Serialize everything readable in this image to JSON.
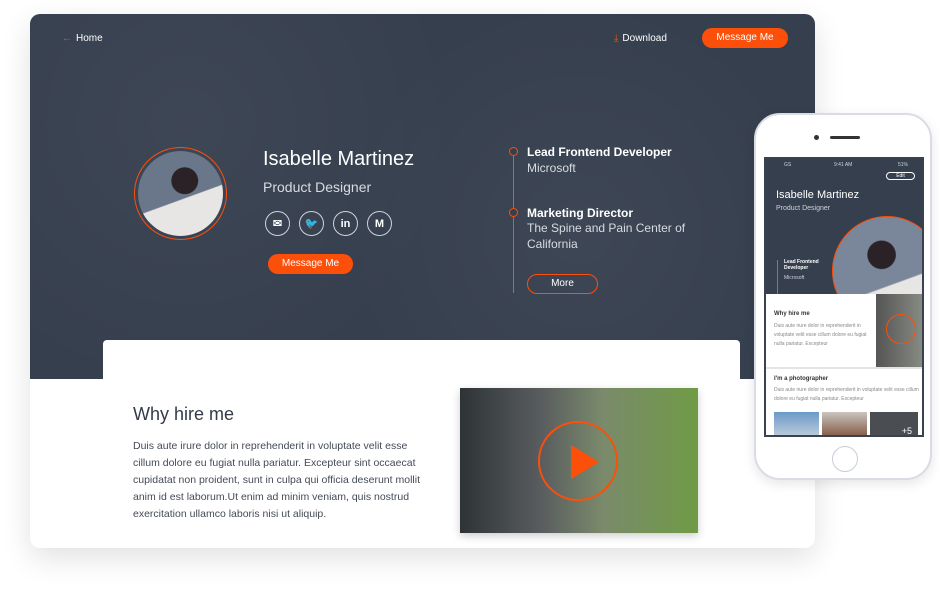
{
  "accent": "#fc4f0a",
  "header": {
    "home_label": "Home",
    "download_label": "Download",
    "message_label": "Message Me"
  },
  "profile": {
    "name": "Isabelle Martinez",
    "role": "Product Designer",
    "socials": [
      {
        "icon": "mail-icon",
        "glyph": "✉"
      },
      {
        "icon": "twitter-icon",
        "glyph": "🐦"
      },
      {
        "icon": "linkedin-icon",
        "glyph": "in"
      },
      {
        "icon": "medium-icon",
        "glyph": "M"
      }
    ],
    "message_label": "Message Me"
  },
  "experience": [
    {
      "title": "Lead Frontend Developer",
      "company": "Microsoft"
    },
    {
      "title": "Marketing Director",
      "company": "The Spine and Pain Center of California"
    }
  ],
  "more_label": "More",
  "why": {
    "title": "Why hire me",
    "text": "Duis aute irure dolor in reprehenderit in voluptate velit esse cillum dolore eu fugiat nulla pariatur. Excepteur sint occaecat cupidatat non proident, sunt in culpa qui officia deserunt mollit anim id est laborum.Ut enim ad minim veniam, quis nostrud exercitation ullamco laboris nisi ut aliquip."
  },
  "mobile": {
    "time": "9:41 AM",
    "battery": "51%",
    "carrier": "GS",
    "edit_label": "Edit",
    "name": "Isabelle Martinez",
    "role": "Product Designer",
    "job_title": "Lead Frontend Developer",
    "job_company": "Microsoft",
    "why_title": "Why hire me",
    "why_text": "Duis aute irure dolor in reprehenderit in voluptate velit esse cillum dolore eu fugiat nulla pariatur. Excepteur",
    "photo_title": "I'm a photographer",
    "photo_text": "Duis aute irure dolor in reprehenderit in voluptate velit esse cillum dolore eu fugiat nulla pariatur. Excepteur",
    "more_photos": "+5"
  }
}
